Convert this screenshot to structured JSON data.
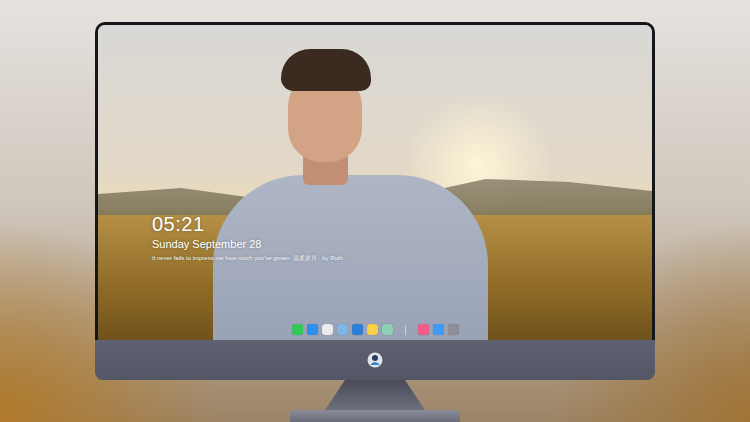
{
  "lock_screen": {
    "time": "05:21",
    "date": "Sunday September 28",
    "quote": "It never fails to impress me how much you've grown. 温柔岁月 · by Ruth"
  },
  "dock": {
    "apps": [
      {
        "color": "#34c759"
      },
      {
        "color": "#2f8ff0"
      },
      {
        "color": "#e9e9ee"
      },
      {
        "color": "#7fb6e8"
      },
      {
        "color": "#2b7fd6"
      },
      {
        "color": "#f7d046"
      },
      {
        "color": "#8fd0b5"
      }
    ],
    "recent": [
      {
        "color": "#f25c8a"
      },
      {
        "color": "#3d9cf5"
      },
      {
        "color": "#8e8e96"
      }
    ]
  }
}
